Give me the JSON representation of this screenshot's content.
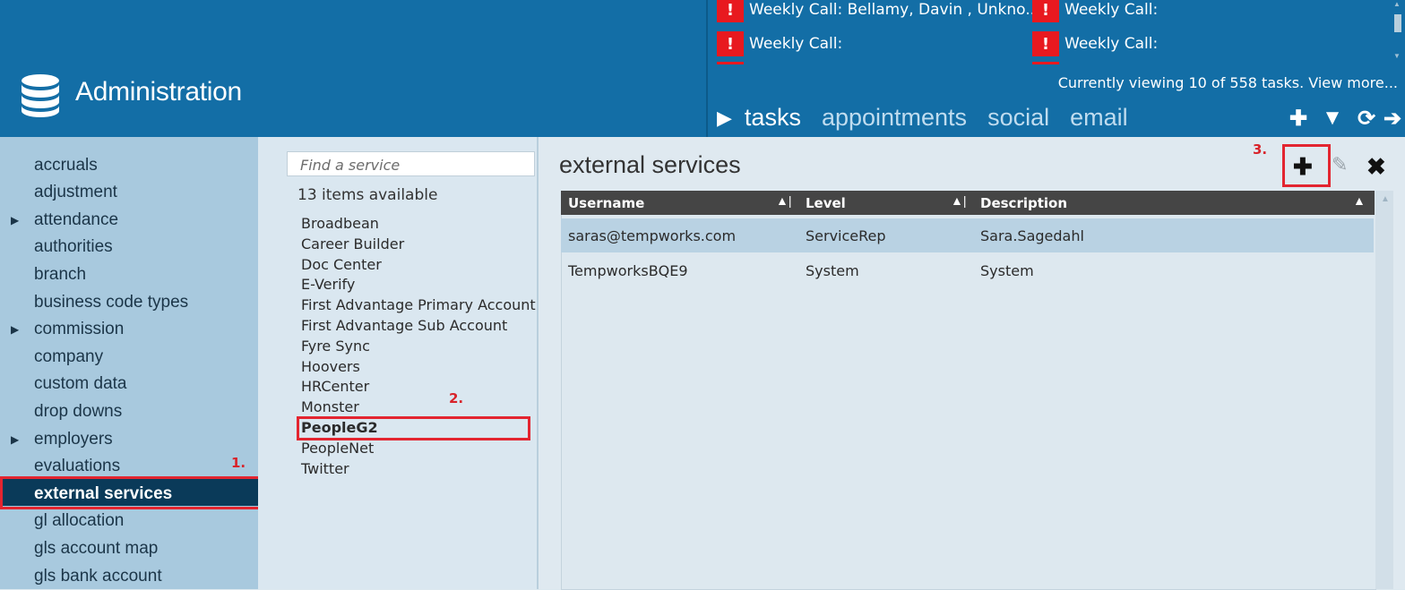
{
  "header": {
    "app_title": "Administration",
    "tasks": [
      "Weekly Call: Bellamy, Davin , Unkno...",
      "Weekly Call:",
      "Weekly Call:",
      "Weekly Call:"
    ],
    "alert_glyph": "!",
    "tasks_status": "Currently viewing 10 of 558 tasks. View more...",
    "tabs": [
      "tasks",
      "appointments",
      "social",
      "email"
    ],
    "active_tab": "tasks",
    "tools": [
      "plus-icon",
      "filter-icon",
      "refresh-icon",
      "arrow-right-icon"
    ]
  },
  "sidebar": {
    "items": [
      {
        "label": "accruals",
        "caret": false
      },
      {
        "label": "adjustment",
        "caret": false
      },
      {
        "label": "attendance",
        "caret": true
      },
      {
        "label": "authorities",
        "caret": false
      },
      {
        "label": "branch",
        "caret": false
      },
      {
        "label": "business code types",
        "caret": false
      },
      {
        "label": "commission",
        "caret": true
      },
      {
        "label": "company",
        "caret": false
      },
      {
        "label": "custom data",
        "caret": false
      },
      {
        "label": "drop downs",
        "caret": false
      },
      {
        "label": "employers",
        "caret": true
      },
      {
        "label": "evaluations",
        "caret": false
      },
      {
        "label": "external services",
        "caret": false,
        "selected": true
      },
      {
        "label": "gl allocation",
        "caret": false
      },
      {
        "label": "gls account map",
        "caret": false
      },
      {
        "label": "gls bank account",
        "caret": false
      }
    ]
  },
  "annotations": {
    "a1": "1.",
    "a2": "2.",
    "a3": "3."
  },
  "services": {
    "search_placeholder": "Find a service",
    "count_label": "13 items available",
    "items": [
      "Broadbean",
      "Career Builder",
      "Doc Center",
      "E-Verify",
      "First Advantage Primary Account",
      "First Advantage Sub Account",
      "Fyre Sync",
      "Hoovers",
      "HRCenter",
      "Monster",
      "PeopleG2",
      "PeopleNet",
      "Twitter"
    ],
    "selected": "PeopleG2"
  },
  "main": {
    "title": "external services",
    "columns": [
      "Username",
      "Level",
      "Description"
    ],
    "rows": [
      [
        "saras@tempworks.com",
        "ServiceRep",
        "Sara.Sagedahl"
      ],
      [
        "TempworksBQE9",
        "System",
        "System"
      ]
    ]
  },
  "colors": {
    "header_bg": "#136ea6",
    "sidebar_bg": "#a8c9de",
    "selected_bg": "#0a3a59",
    "alert_red": "#e8191f",
    "annotation_red": "#e32530"
  }
}
